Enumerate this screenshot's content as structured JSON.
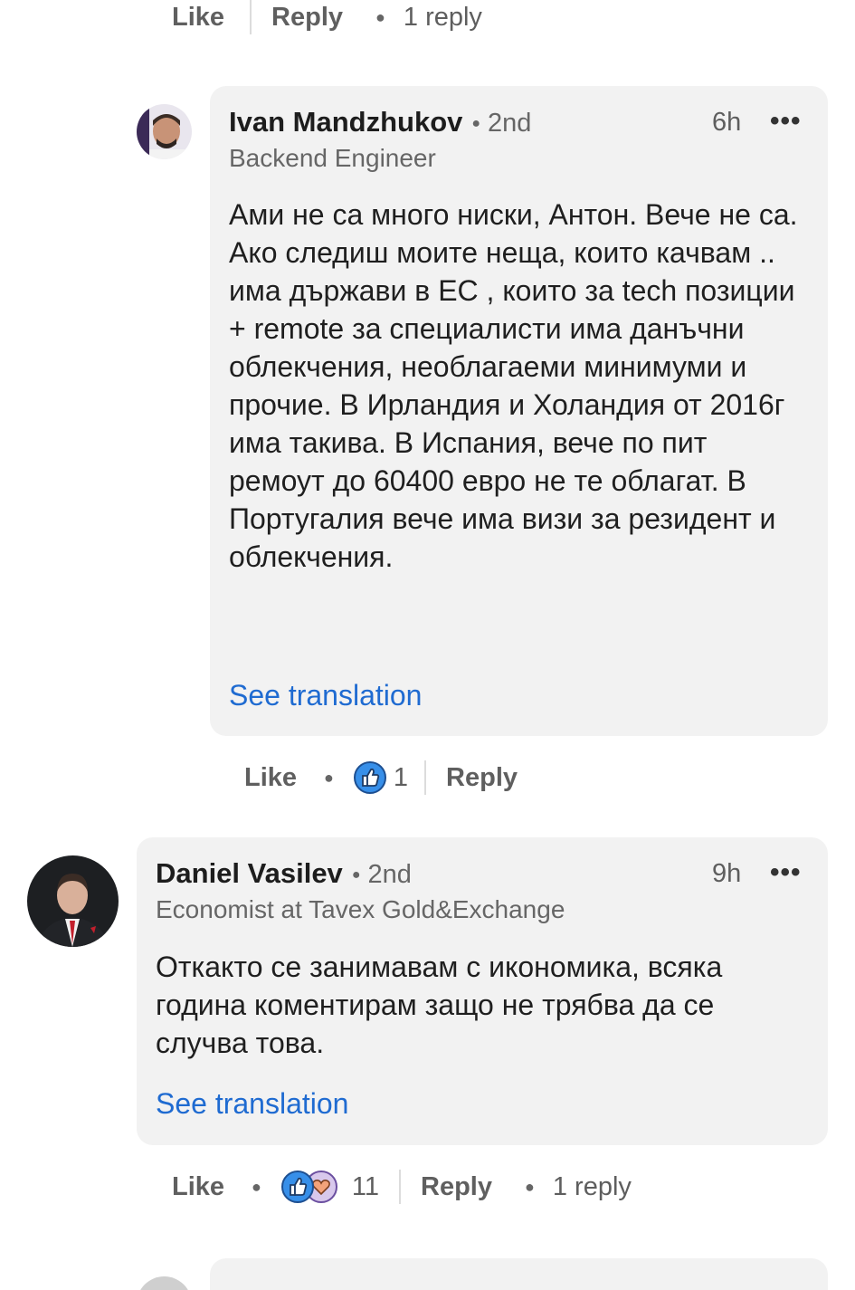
{
  "top_actions": {
    "like_label": "Like",
    "reply_label": "Reply",
    "replies_count": "1 reply"
  },
  "comment1": {
    "author": "Ivan Mandzhukov",
    "degree": "2nd",
    "headline": "Backend Engineer",
    "time": "6h",
    "more": "•••",
    "text": "Ами не са много ниски, Антон. Вече не са. Ако следиш моите неща, които качвам .. има държави в ЕС , които за tech позиции + remote за специалисти има данъчни облекчения, необлагаеми минимуми и прочие. В Ирландия и Холандия от 2016г има такива. В Испания, вече по пит ремоут до 60400 евро не те облагат. В Португалия вече има визи за резидент и облекчения.",
    "translate_label": "See translation",
    "actions": {
      "like_label": "Like",
      "reaction_count": "1",
      "reply_label": "Reply"
    }
  },
  "comment2": {
    "author": "Daniel Vasilev",
    "degree": "2nd",
    "headline": "Economist at Tavex Gold&Exchange",
    "time": "9h",
    "more": "•••",
    "text": "Откакто се занимавам с икономика, всяка година коментирам защо не трябва да се случва това.",
    "translate_label": "See translation",
    "actions": {
      "like_label": "Like",
      "reaction_count": "11",
      "reply_label": "Reply",
      "replies_count": "1 reply"
    }
  },
  "colors": {
    "link_blue": "#1f6bd1",
    "bubble_bg": "#f2f2f2",
    "like_blue": "#378fe9"
  },
  "icons": {
    "like": "like-thumb-icon",
    "love": "love-heart-icon",
    "more": "more-horizontal-icon"
  }
}
